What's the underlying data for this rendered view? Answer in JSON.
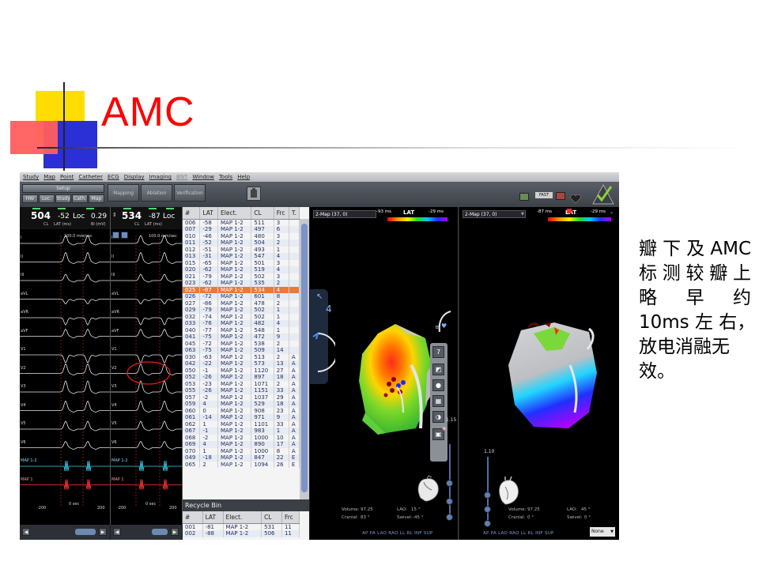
{
  "slide": {
    "title": "AMC",
    "caption_lines": [
      "瓣下及AMC",
      "标测较瓣上",
      "略 早 约",
      "10ms 左 右，",
      "放电消融无",
      "效。"
    ]
  },
  "menu": [
    "Study",
    "Map",
    "Point",
    "Catheter",
    "ECG",
    "Display",
    "Imaging",
    "BNT",
    "Window",
    "Tools",
    "Help"
  ],
  "toolbar": {
    "setup": "Setup",
    "tabs": [
      "HW",
      "Loc.",
      "Study",
      "Cath.",
      "Map"
    ],
    "big_buttons": [
      "Mapping",
      "Ablation",
      "Verification"
    ],
    "fast_badge": "FAST"
  },
  "ecg_left": {
    "cl": "504",
    "lat": "-52",
    "loc": "Loc",
    "bi": "0.29",
    "cl_unit": "CL",
    "lat_unit": "LAT (ms)",
    "bi_unit": "Bi (mV)",
    "speed": "100.0 mm/sec",
    "leads": [
      "I",
      "II",
      "III",
      "aVL",
      "aVR",
      "aVF",
      "V1",
      "V2",
      "V3",
      "V4",
      "V5",
      "V6",
      "MAP 1-2",
      "MAP 1"
    ],
    "scale_left": "-200",
    "scale_right": "200",
    "sec": "0 sec"
  },
  "ecg_right": {
    "cl": "534",
    "lat": "-87",
    "loc": "Loc",
    "cl_unit": "CL",
    "lat_unit": "LAT (ms)",
    "speed": "100.0 mm/sec",
    "leads": [
      "I",
      "II",
      "III",
      "aVL",
      "aVR",
      "aVF",
      "V1",
      "V2",
      "V3",
      "V4",
      "V5",
      "V6",
      "MAP 1-2",
      "MAP 1"
    ],
    "scale_left": "-200",
    "scale_right": "200",
    "sec": "0 sec"
  },
  "table": {
    "headers": [
      "#",
      "LAT",
      "Elect.",
      "CL",
      "Frc",
      "T."
    ],
    "rows": [
      [
        "006",
        "-58",
        "MAP 1-2",
        "511",
        "3",
        ""
      ],
      [
        "007",
        "-29",
        "MAP 1-2",
        "497",
        "6",
        ""
      ],
      [
        "010",
        "-46",
        "MAP 1-2",
        "480",
        "3",
        ""
      ],
      [
        "011",
        "-52",
        "MAP 1-2",
        "504",
        "2",
        ""
      ],
      [
        "012",
        "-51",
        "MAP 1-2",
        "493",
        "1",
        ""
      ],
      [
        "013",
        "-31",
        "MAP 1-2",
        "547",
        "4",
        ""
      ],
      [
        "015",
        "-65",
        "MAP 1-2",
        "501",
        "3",
        ""
      ],
      [
        "020",
        "-62",
        "MAP 1-2",
        "519",
        "4",
        ""
      ],
      [
        "021",
        "-79",
        "MAP 1-2",
        "502",
        "3",
        ""
      ],
      [
        "023",
        "-62",
        "MAP 1-2",
        "535",
        "2",
        ""
      ],
      [
        "025",
        "-87",
        "MAP 1-2",
        "534",
        "4",
        ""
      ],
      [
        "026",
        "-72",
        "MAP 1-2",
        "601",
        "8",
        ""
      ],
      [
        "027",
        "-86",
        "MAP 1-2",
        "478",
        "2",
        ""
      ],
      [
        "029",
        "-79",
        "MAP 1-2",
        "502",
        "1",
        ""
      ],
      [
        "032",
        "-74",
        "MAP 1-2",
        "502",
        "1",
        ""
      ],
      [
        "033",
        "-76",
        "MAP 1-2",
        "482",
        "4",
        ""
      ],
      [
        "040",
        "-77",
        "MAP 1-2",
        "548",
        "1",
        ""
      ],
      [
        "041",
        "-75",
        "MAP 1-2",
        "472",
        "9",
        ""
      ],
      [
        "045",
        "-72",
        "MAP 1-2",
        "538",
        "2",
        ""
      ],
      [
        "063",
        "-75",
        "MAP 1-2",
        "509",
        "14",
        ""
      ],
      [
        "030",
        "-63",
        "MAP 1-2",
        "513",
        "2",
        "A"
      ],
      [
        "042",
        "-22",
        "MAP 1-2",
        "573",
        "13",
        "A"
      ],
      [
        "050",
        "-1",
        "MAP 1-2",
        "1120",
        "27",
        "A"
      ],
      [
        "052",
        "-26",
        "MAP 1-2",
        "897",
        "18",
        "A"
      ],
      [
        "053",
        "-23",
        "MAP 1-2",
        "1071",
        "2",
        "A"
      ],
      [
        "055",
        "-26",
        "MAP 1-2",
        "1151",
        "33",
        "A"
      ],
      [
        "057",
        "-2",
        "MAP 1-2",
        "1037",
        "29",
        "A"
      ],
      [
        "059",
        "4",
        "MAP 1-2",
        "529",
        "18",
        "A"
      ],
      [
        "060",
        "0",
        "MAP 1-2",
        "908",
        "23",
        "A"
      ],
      [
        "061",
        "-14",
        "MAP 1-2",
        "971",
        "9",
        "A"
      ],
      [
        "062",
        "1",
        "MAP 1-2",
        "1101",
        "33",
        "A"
      ],
      [
        "067",
        "-1",
        "MAP 1-2",
        "983",
        "1",
        "A"
      ],
      [
        "068",
        "-2",
        "MAP 1-2",
        "1000",
        "10",
        "A"
      ],
      [
        "069",
        "4",
        "MAP 1-2",
        "890",
        "17",
        "A"
      ],
      [
        "070",
        "1",
        "MAP 1-2",
        "1000",
        "8",
        "A"
      ],
      [
        "049",
        "-18",
        "MAP 1-2",
        "847",
        "22",
        "E"
      ],
      [
        "065",
        "2",
        "MAP 1-2",
        "1094",
        "26",
        "E"
      ]
    ],
    "selected_index": 10,
    "recycle_label": "Recycle Bin",
    "recycle_headers": [
      "#",
      "LAT",
      "Elect.",
      "CL",
      "Frc"
    ],
    "recycle_rows": [
      [
        "001",
        "-81",
        "MAP 1-2",
        "531",
        "11"
      ],
      [
        "002",
        "-88",
        "MAP 1-2",
        "506",
        "11"
      ]
    ]
  },
  "map_left": {
    "title": "2-Map (37, 0)",
    "lat": "LAT",
    "ms_left": "-93 ms",
    "ms_right": "-29 ms",
    "volume_label": "Volume:",
    "volume": "97.25",
    "lao_label": "LAO:",
    "lao": "15 °",
    "cranial_label": "Cranial:",
    "cranial": "83 °",
    "swivel_label": "Swivel:",
    "swivel": "-45 °",
    "tool_value": "7",
    "slider_value": "1.15",
    "side_value": "4",
    "views": "AP  PA  LAO  RAO  LL  RL  INF  SUP"
  },
  "map_right": {
    "title": "2-Map (37, 0)",
    "lat": "LAT",
    "ms_left": "-87 ms",
    "ms_right": "-29 ms",
    "volume_label": "Volume:",
    "volume": "97.25",
    "lao_label": "LAO:",
    "lao": "45 °",
    "cranial_label": "Cranial:",
    "cranial": "0 °",
    "swivel_label": "Swivel:",
    "swivel": "0 °",
    "slider_value": "1.10",
    "views": "AP  PA  LAO  RAO  LL  RL  INF  SUP",
    "select_value": "None"
  },
  "colors": {
    "title_red": "#ff0000",
    "selected_row": "#e77b3a",
    "map_red": "#ff0000",
    "map_green": "#22dd22",
    "map_blue": "#2030ff"
  }
}
